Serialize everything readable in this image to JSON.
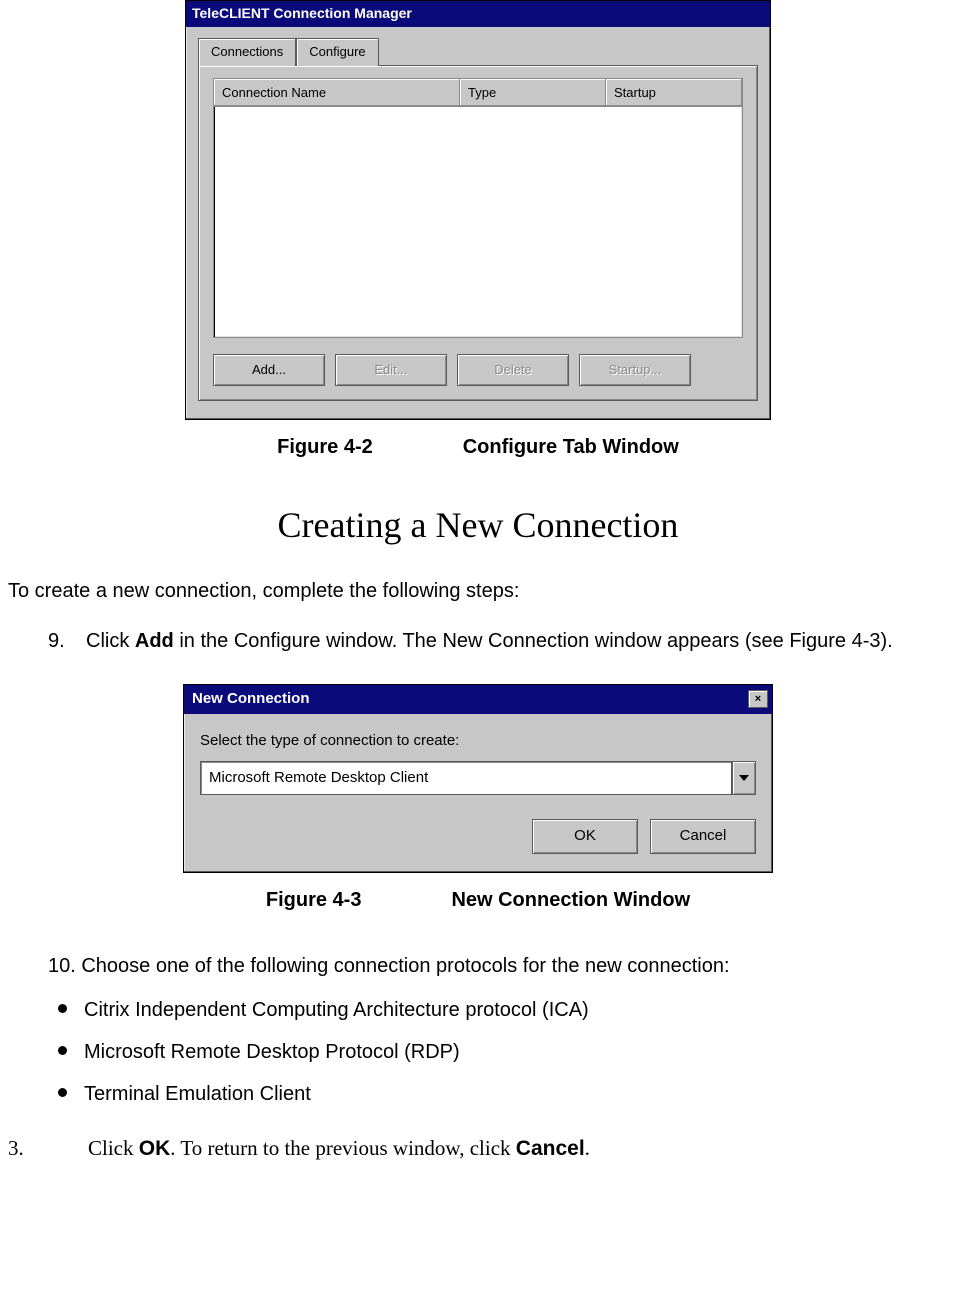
{
  "cm": {
    "title": "TeleCLIENT Connection Manager",
    "tabs": {
      "connections": "Connections",
      "configure": "Configure"
    },
    "cols": {
      "name": "Connection Name",
      "type": "Type",
      "startup": "Startup"
    },
    "buttons": {
      "add": "Add...",
      "edit": "Edit...",
      "delete": "Delete",
      "startup": "Startup..."
    }
  },
  "fig42": {
    "num": "Figure 4-2",
    "title": "Configure Tab Window"
  },
  "heading": "Creating a New Connection",
  "intro": "To create a new connection, complete the following steps:",
  "step9": {
    "num": "9.",
    "pre": "Click ",
    "bold": "Add",
    "post": " in the Configure window. The New Connection window appears (see Figure 4-3)."
  },
  "nc": {
    "title": "New Connection",
    "close": "×",
    "label": "Select the type of connection to create:",
    "selection": "Microsoft Remote Desktop Client",
    "ok": "OK",
    "cancel": "Cancel"
  },
  "fig43": {
    "num": "Figure 4-3",
    "title": "New Connection Window"
  },
  "step10": "10. Choose one of the following connection protocols for the new connection:",
  "bullets": [
    "Citrix Independent Computing Architecture protocol (ICA)",
    "Microsoft Remote Desktop Protocol (RDP)",
    "Terminal Emulation Client"
  ],
  "step3": {
    "num": "3.",
    "a": "Click ",
    "b1": "OK",
    "b": ". To return to the previous window, click ",
    "b2": "Cancel",
    "c": "."
  }
}
